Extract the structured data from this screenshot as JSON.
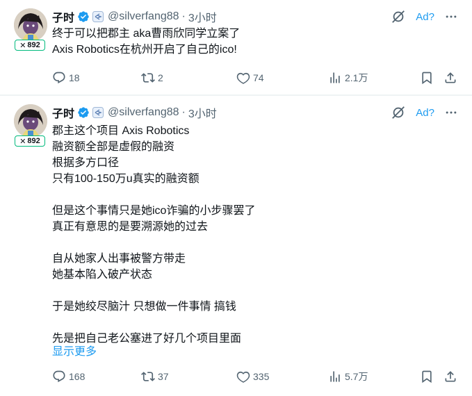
{
  "tweets": [
    {
      "name": "子时",
      "handle": "@silverfang88",
      "dot": "·",
      "time": "3小时",
      "ad_label": "Ad?",
      "badge_x": "✕",
      "badge_count": "892",
      "text": "终于可以把郡主 aka曹雨欣同学立案了\nAxis Robotics在杭州开启了自己的ico!",
      "replies": "18",
      "retweets": "2",
      "likes": "74",
      "views": "2.1万"
    },
    {
      "name": "子时",
      "handle": "@silverfang88",
      "dot": "·",
      "time": "3小时",
      "ad_label": "Ad?",
      "badge_x": "✕",
      "badge_count": "892",
      "text": "郡主这个项目 Axis Robotics\n融资额全部是虚假的融资\n根据多方口径\n只有100-150万u真实的融资额\n\n但是这个事情只是她ico诈骗的小步骤罢了\n真正有意思的是要溯源她的过去\n\n自从她家人出事被警方带走\n她基本陷入破产状态\n\n于是她绞尽脑汁 只想做一件事情 搞钱\n\n先是把自己老公塞进了好几个项目里面",
      "show_more": "显示更多",
      "replies": "168",
      "retweets": "37",
      "likes": "335",
      "views": "5.7万"
    }
  ],
  "colors": {
    "accent": "#1d9bf0",
    "muted": "#536471",
    "text": "#0f1419",
    "badge_border": "#00ba7c"
  },
  "icons": [
    "verified-badge-icon",
    "subscription-badge-icon",
    "grok-slash-icon",
    "more-dots-icon",
    "reply-icon",
    "retweet-icon",
    "like-icon",
    "views-icon",
    "bookmark-icon",
    "share-icon"
  ]
}
